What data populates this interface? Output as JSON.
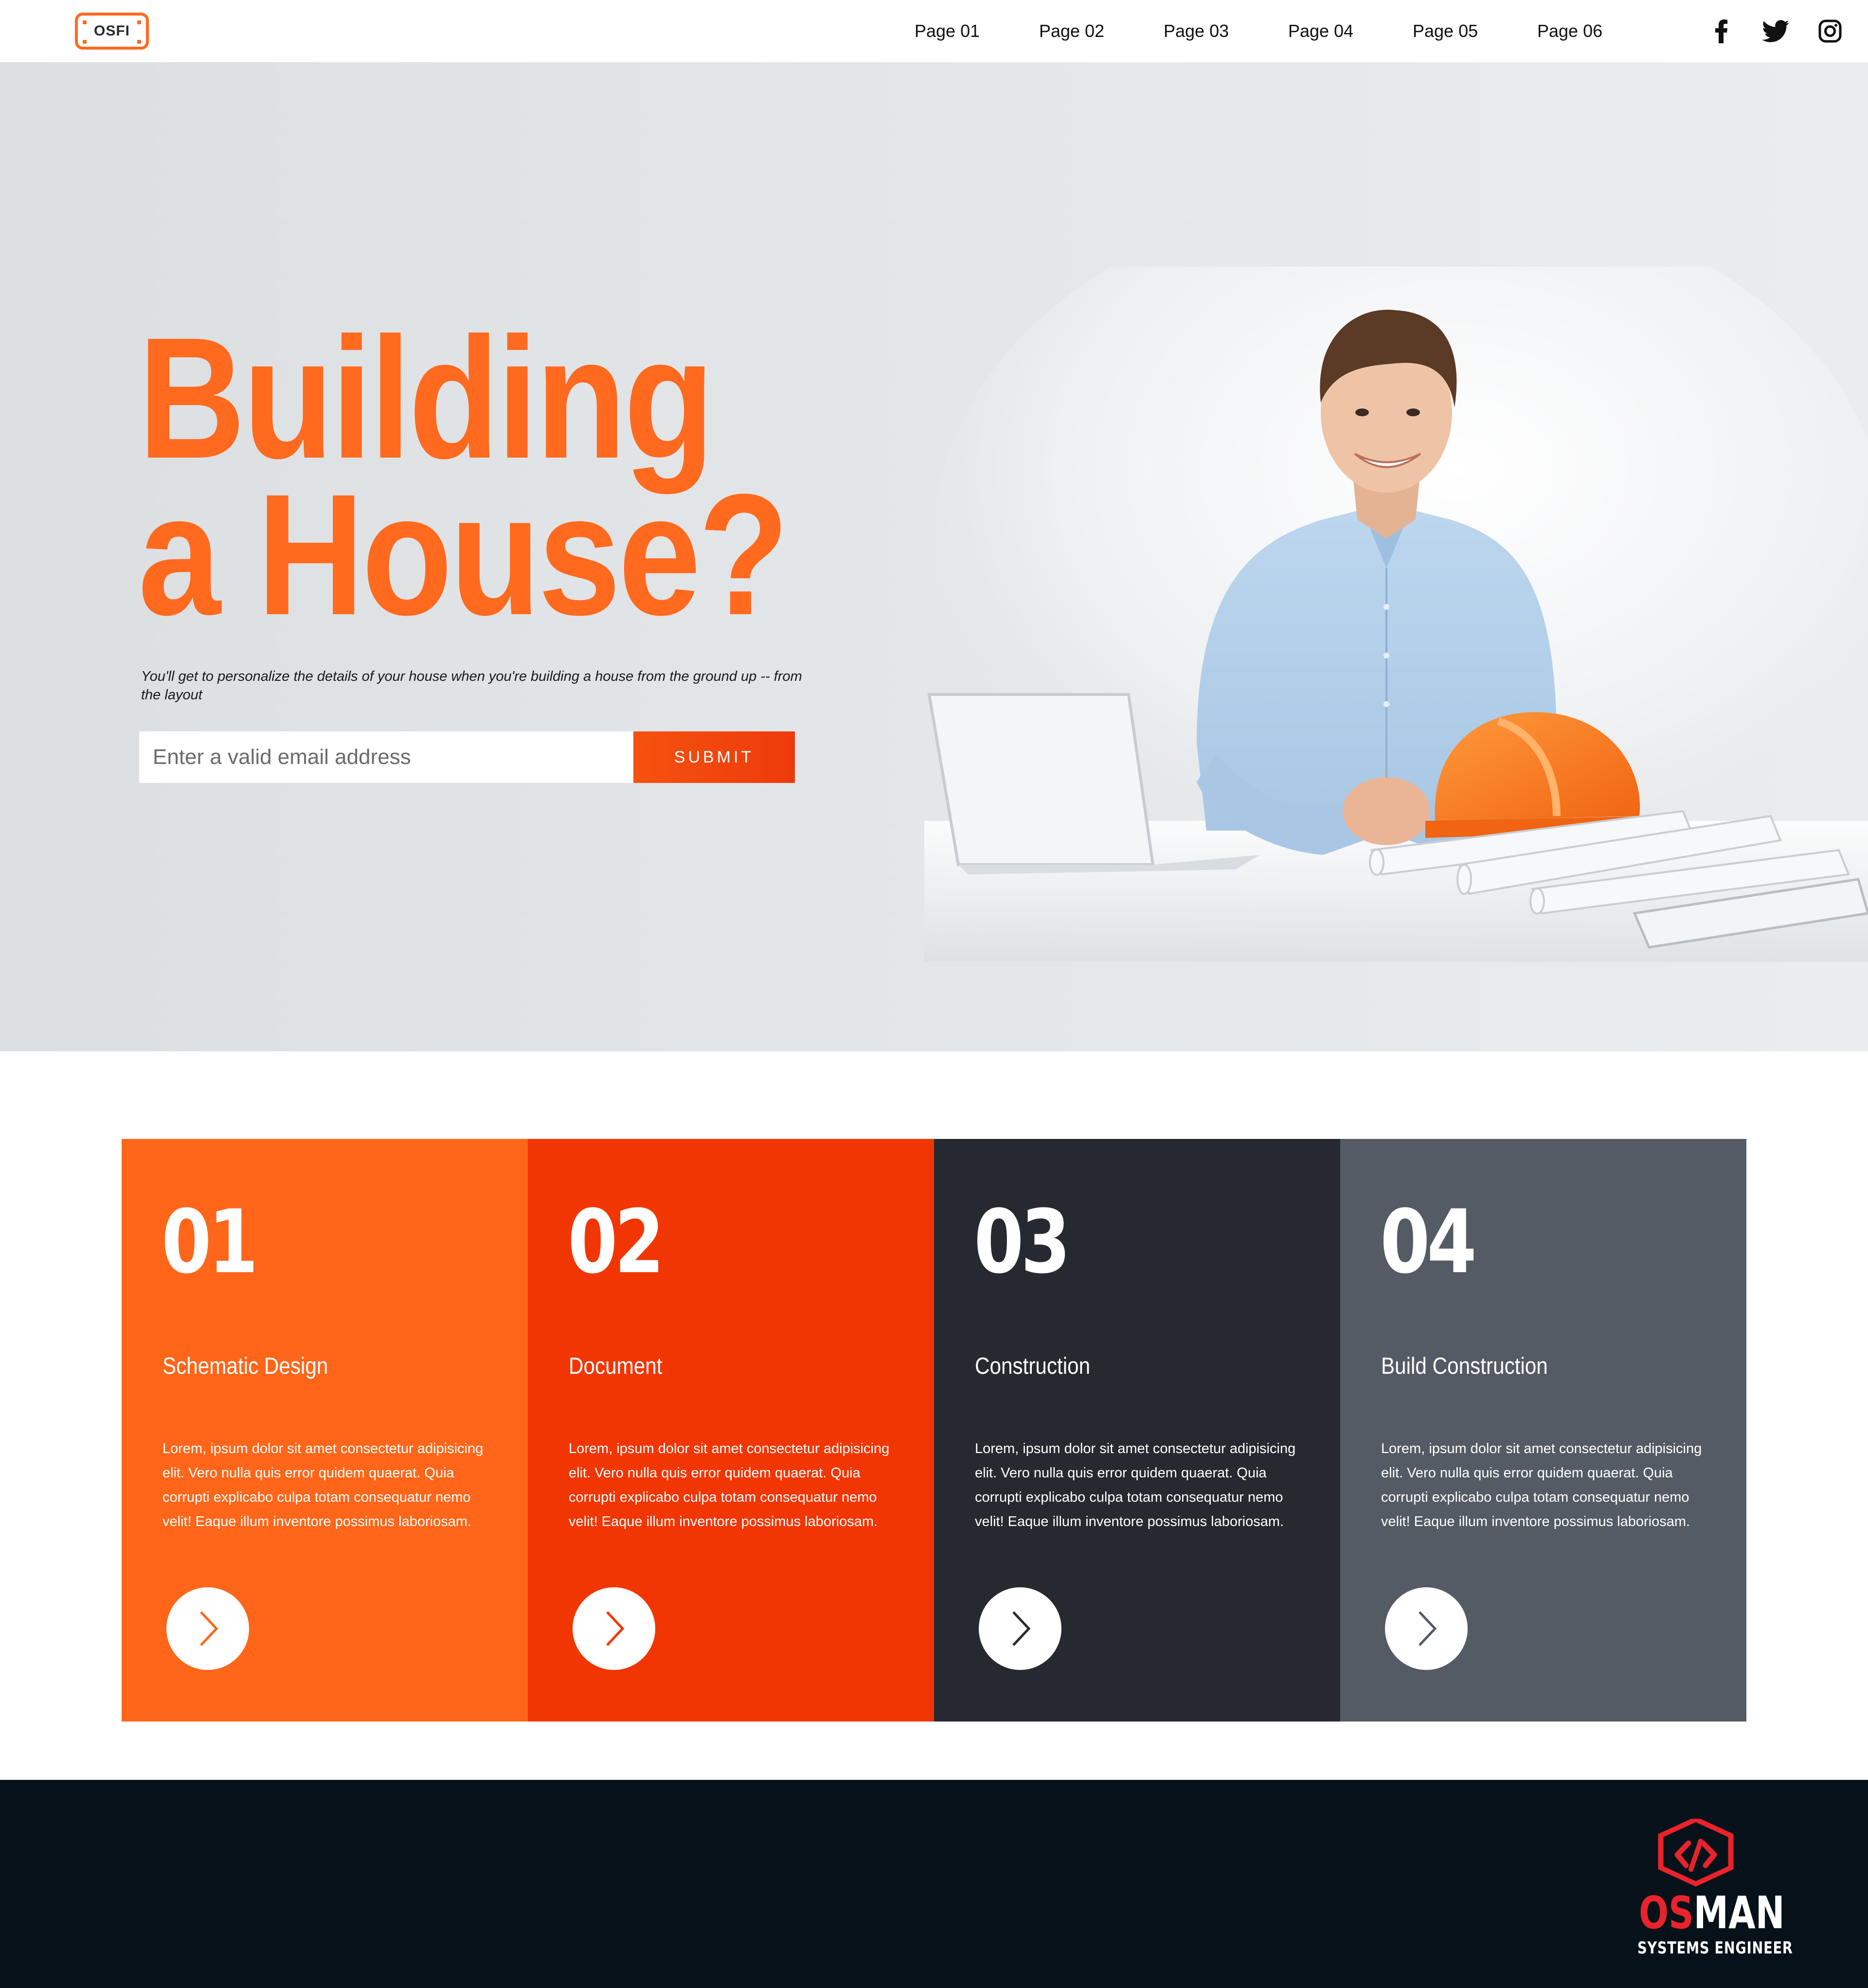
{
  "header": {
    "logo_text": "OSFI",
    "nav": [
      "Page 01",
      "Page 02",
      "Page 03",
      "Page 04",
      "Page 05",
      "Page 06"
    ],
    "social_icons": [
      "facebook-icon",
      "twitter-icon",
      "instagram-icon"
    ]
  },
  "hero": {
    "title_line1": "Building",
    "title_line2": "a House?",
    "subtitle": "You'll get to personalize the details of your house when you're building a house from the ground up -- from the layout",
    "email_placeholder": "Enter a valid email address",
    "submit_label": "SUBMIT",
    "accent_color": "#ff6a1f"
  },
  "steps": [
    {
      "number": "01",
      "title": "Schematic Design",
      "body": "Lorem, ipsum dolor sit amet consectetur adipisicing elit. Vero nulla quis error quidem quaerat. Quia corrupti explicabo culpa totam consequatur nemo velit! Eaque illum inventore possimus laboriosam.",
      "bg": "#ff661a",
      "arrow_color": "#ff661a"
    },
    {
      "number": "02",
      "title": "Document",
      "body": "Lorem, ipsum dolor sit amet consectetur adipisicing elit. Vero nulla quis error quidem quaerat. Quia corrupti explicabo culpa totam consequatur nemo velit! Eaque illum inventore possimus laboriosam.",
      "bg": "#f23603",
      "arrow_color": "#f23603"
    },
    {
      "number": "03",
      "title": "Construction",
      "body": "Lorem, ipsum dolor sit amet consectetur adipisicing elit. Vero nulla quis error quidem quaerat. Quia corrupti explicabo culpa totam consequatur nemo velit! Eaque illum inventore possimus laboriosam.",
      "bg": "#262a30",
      "arrow_color": "#262a30"
    },
    {
      "number": "04",
      "title": "Build Construction",
      "body": "Lorem, ipsum dolor sit amet consectetur adipisicing elit. Vero nulla quis error quidem quaerat. Quia corrupti explicabo culpa totam consequatur nemo velit! Eaque illum inventore possimus laboriosam.",
      "bg": "#555b64",
      "arrow_color": "#555b64"
    }
  ],
  "footer": {
    "brand_os": "OS",
    "brand_man": "MAN",
    "brand_tagline": "SYSTEMS ENGINEER",
    "bg": "#07111a",
    "brand_red": "#e8232b"
  }
}
